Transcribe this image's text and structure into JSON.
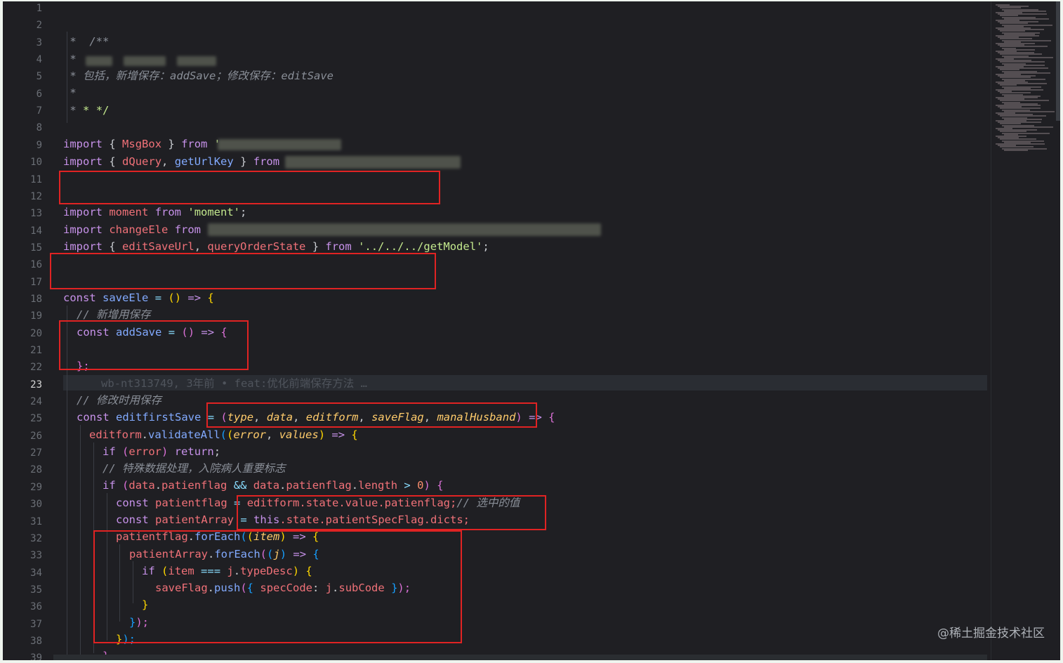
{
  "editor": {
    "line_numbers": [
      "1",
      "2",
      "3",
      "4",
      "5",
      "6",
      "7",
      "8",
      "9",
      "10",
      "11",
      "12",
      "13",
      "14",
      "15",
      "16",
      "17",
      "18",
      "19",
      "20",
      "21",
      "22",
      "23",
      "24",
      "25",
      "26",
      "27",
      "28",
      "29",
      "30",
      "31",
      "32",
      "33",
      "34",
      "35",
      "36",
      "37",
      "38",
      "39"
    ],
    "active_line": "23",
    "code": {
      "l2": "/**",
      "l3": "*",
      "l4": "*",
      "l5": "* 包括，新增保存：addSave；修改保存：editSave",
      "l6": "*",
      "l7_star": "*",
      "l7_rest": "* */",
      "kw_import": "import",
      "kw_from": "from",
      "kw_const": "const",
      "kw_if": "if",
      "kw_return": "return",
      "kw_this": "this",
      "brace_open": "{",
      "brace_close": "}",
      "comma": ",",
      "semicolon": ";",
      "dot": ".",
      "l9_msgbox": "MsgBox",
      "l9_quote": "'",
      "l10_dquery": "dQuery",
      "l10_geturlkey": "getUrlKey",
      "l13_moment": "moment",
      "l13_str": "'moment'",
      "l14_changeele": "changeEle",
      "l15_editsaveurl": "editSaveUrl",
      "l15_queryorderstate": "queryOrderState",
      "l15_str": "'../../../getModel'",
      "l18_saveele": "saveEle",
      "eq": "=",
      "arrow": "=>",
      "empty_parens": "()",
      "l19_comment": "// 新增用保存",
      "l20_addsave": "addSave",
      "l22_close": "};",
      "l23_blame": "wb-nt313749, 3年前 • feat:优化前端保存方法 …",
      "l24_comment": "// 修改时用保存",
      "l25_editfirstsave": "editfirstSave",
      "paren_open": "(",
      "paren_close": ")",
      "p_type": "type",
      "p_data": "data",
      "p_editform": "editform",
      "p_saveflag": "saveFlag",
      "p_manalhusband": "manalHusband",
      "l26_editform": "editform",
      "l26_validateall": "validateAll",
      "p_error": "error",
      "p_values": "values",
      "l27_error": "error",
      "l28_comment": "// 特殊数据处理，入院病人重要标志",
      "l29_data": "data",
      "l29_patienflag": "patienflag",
      "l29_and": "&&",
      "l29_length": "length",
      "l29_gt": ">",
      "l29_zero": "0",
      "l30_patientflag": "patientflag",
      "l30_expr": "editform.state.value.patienflag;",
      "l30_comment": "// 选中的值",
      "l31_patientarray": "patientArray",
      "l31_rest": ".state.patientSpecFlag.dicts;",
      "l32_patientflag": "patientflag",
      "foreach": "forEach",
      "p_item": "item",
      "l33_patientarray": "patientArray",
      "p_j": "j",
      "l34_item": "item",
      "l34_eqeqeq": "===",
      "l34_j": "j",
      "l34_typedesc": "typeDesc",
      "l35_saveflag": "saveFlag",
      "l35_push": "push",
      "l35_speccode": "specCode",
      "colon": ":",
      "l35_j": "j",
      "l35_subcode": "subCode",
      "close_paren_semi": ");"
    }
  },
  "watermark": "@稀土掘金技术社区",
  "colors": {
    "editor_bg": "#1f1f23",
    "keyword": "#c792ea",
    "function": "#82aaff",
    "string": "#c3e88d",
    "comment": "#8a8f98",
    "identifier": "#f07178",
    "parameter": "#ffcb6b",
    "highlight_box": "#e02323"
  }
}
